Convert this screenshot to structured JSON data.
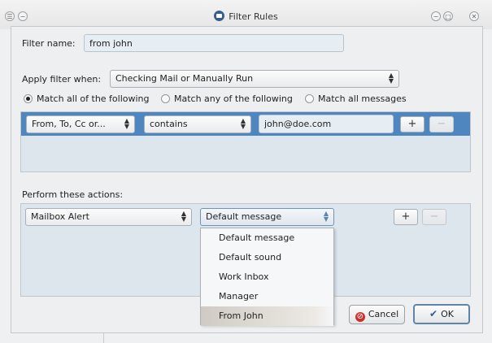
{
  "window": {
    "title": "Filter Rules",
    "controls": [
      "menu",
      "help",
      "minimize",
      "maximize",
      "close"
    ]
  },
  "filter_name": {
    "label": "Filter name:",
    "value": "from john"
  },
  "apply_when": {
    "label": "Apply filter when:",
    "selected": "Checking Mail or Manually Run"
  },
  "match": {
    "options": [
      {
        "label": "Match all of the following",
        "checked": true
      },
      {
        "label": "Match any of the following",
        "checked": false
      },
      {
        "label": "Match all messages",
        "checked": false
      }
    ]
  },
  "rule": {
    "field": "From, To, Cc or...",
    "operator": "contains",
    "value": "john@doe.com",
    "add": "+",
    "remove": "−"
  },
  "actions": {
    "label": "Perform these actions:",
    "action": "Mailbox Alert",
    "target": "Default message",
    "add": "+",
    "remove": "−"
  },
  "dropdown": {
    "items": [
      "Default message",
      "Default sound",
      "Work Inbox",
      "Manager",
      "From John"
    ],
    "selected_index": 4
  },
  "buttons": {
    "cancel": "Cancel",
    "ok": "OK"
  },
  "colors": {
    "selection": "#4f86c0",
    "panel": "#dde5ed",
    "cancel_icon": "#c9302c",
    "accent": "#5d86ad"
  }
}
